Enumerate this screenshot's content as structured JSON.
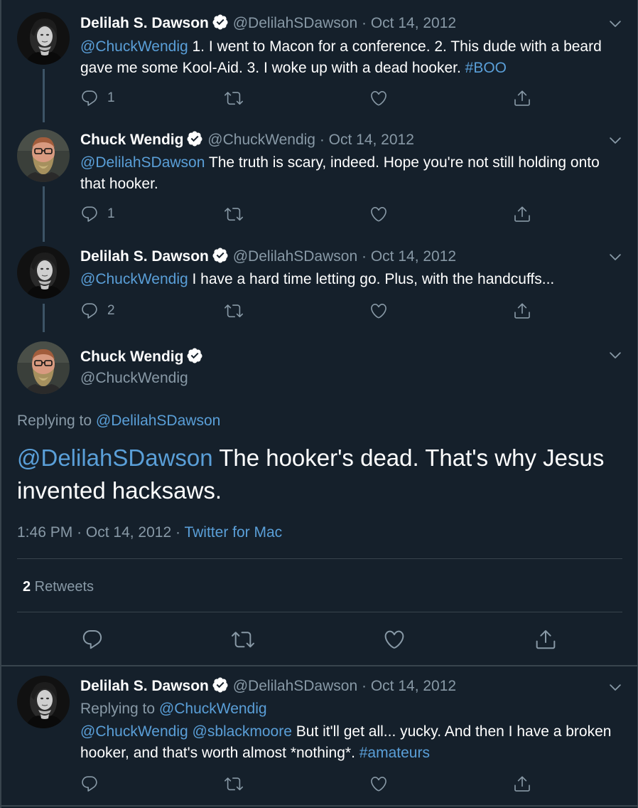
{
  "tweets": [
    {
      "name": "Delilah S. Dawson",
      "handle": "@DelilahSDawson",
      "dot": "·",
      "date": "Oct 14, 2012",
      "mention": "@ChuckWendig",
      "text": " 1. I went to Macon for a conference. 2. This dude with a beard gave me some Kool-Aid. 3. I woke up with a dead hooker. ",
      "hashtag": "#BOO",
      "reply_count": "1"
    },
    {
      "name": "Chuck Wendig",
      "handle": "@ChuckWendig",
      "dot": "·",
      "date": "Oct 14, 2012",
      "mention": "@DelilahSDawson",
      "text": " The truth is scary, indeed. Hope you're not still holding onto that hooker.",
      "reply_count": "1"
    },
    {
      "name": "Delilah S. Dawson",
      "handle": "@DelilahSDawson",
      "dot": "·",
      "date": "Oct 14, 2012",
      "mention": "@ChuckWendig",
      "text": " I have a hard time letting go. Plus, with the handcuffs...",
      "reply_count": "2"
    }
  ],
  "main": {
    "name": "Chuck Wendig",
    "handle": "@ChuckWendig",
    "replying_prefix": "Replying to ",
    "replying_to": "@DelilahSDawson",
    "mention": "@DelilahSDawson",
    "text": " The hooker's dead. That's why Jesus invented hacksaws.",
    "time": "1:46 PM",
    "dot": "·",
    "date": "Oct 14, 2012",
    "dot2": "·",
    "source": "Twitter for Mac",
    "retweet_count": "2",
    "retweet_label": " Retweets"
  },
  "reply": {
    "name": "Delilah S. Dawson",
    "handle": "@DelilahSDawson",
    "dot": "·",
    "date": "Oct 14, 2012",
    "replying_prefix": "Replying to ",
    "replying_to": "@ChuckWendig",
    "mention1": "@ChuckWendig",
    "space": " ",
    "mention2": "@sblackmoore",
    "text": " But it'll get all... yucky. And then I have a broken hooker, and that's worth almost *nothing*. ",
    "hashtag": "#amateurs"
  },
  "colors": {
    "background": "#15202b",
    "link": "#5a9fd8",
    "muted": "#8899a6",
    "divider": "#38444d"
  },
  "icons": [
    "reply-icon",
    "retweet-icon",
    "like-icon",
    "share-icon",
    "verified-badge-icon",
    "chevron-down-icon"
  ]
}
